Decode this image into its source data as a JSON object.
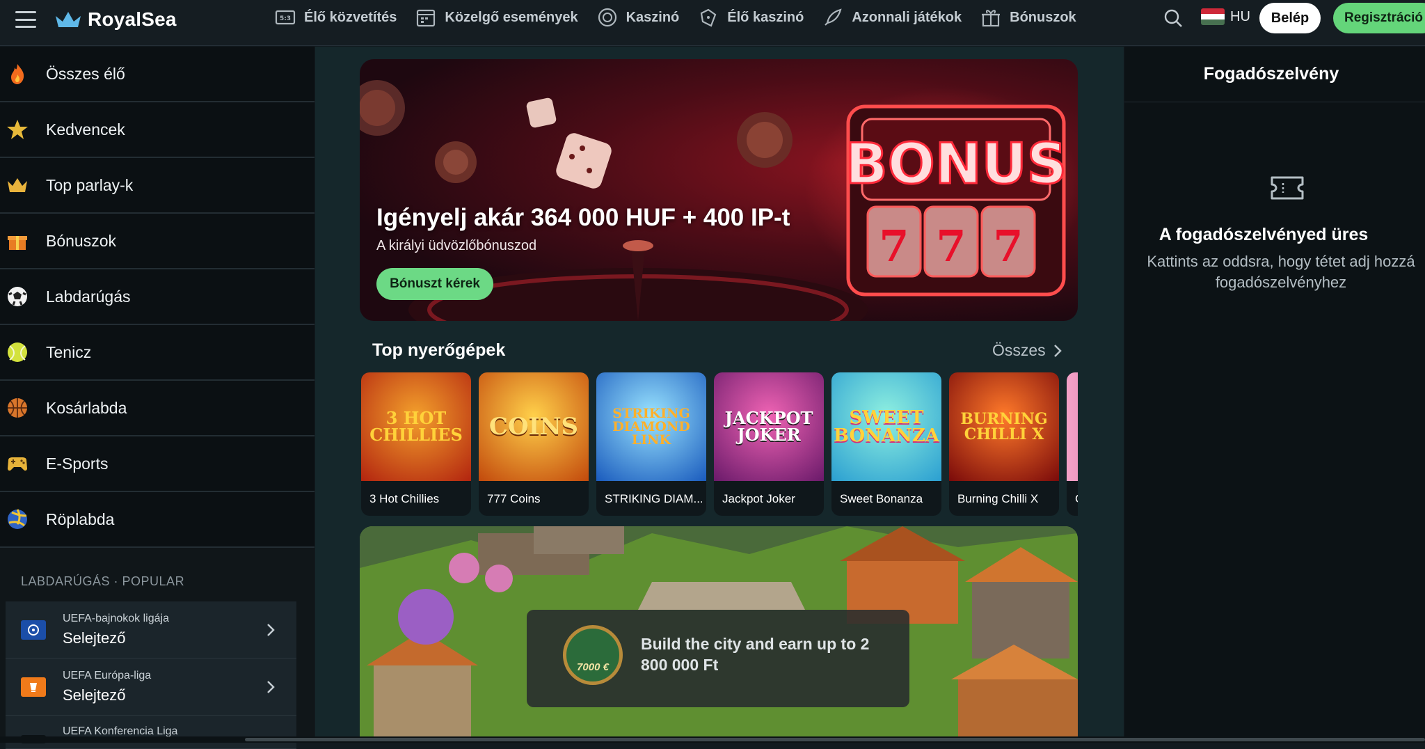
{
  "header": {
    "logo_text": "RoyalSea",
    "nav": [
      {
        "label": "Élő közvetítés",
        "icon": "live-scoreboard-icon"
      },
      {
        "label": "Közelgő események",
        "icon": "calendar-icon"
      },
      {
        "label": "Kaszinó",
        "icon": "casino-chip-icon"
      },
      {
        "label": "Élő kaszinó",
        "icon": "live-casino-icon"
      },
      {
        "label": "Azonnali játékok",
        "icon": "rocket-icon"
      },
      {
        "label": "Bónuszok",
        "icon": "gift-icon"
      }
    ],
    "language": "HU",
    "login_label": "Belép",
    "register_label": "Regisztráció"
  },
  "sidebar": {
    "items": [
      {
        "label": "Összes élő",
        "icon": "fire-icon"
      },
      {
        "label": "Kedvencek",
        "icon": "star-icon"
      },
      {
        "label": "Top parlay-k",
        "icon": "crown-icon"
      },
      {
        "label": "Bónuszok",
        "icon": "gift-icon"
      },
      {
        "label": "Labdarúgás",
        "icon": "soccer-ball-icon"
      },
      {
        "label": "Tenicz",
        "icon": "tennis-ball-icon"
      },
      {
        "label": "Kosárlabda",
        "icon": "basketball-icon"
      },
      {
        "label": "E-Sports",
        "icon": "gamepad-icon"
      },
      {
        "label": "Röplabda",
        "icon": "volleyball-icon"
      }
    ],
    "section_title": "LABDARÚGÁS · POPULAR",
    "leagues": [
      {
        "name": "UEFA-bajnokok ligája",
        "sub": "Selejtező"
      },
      {
        "name": "UEFA Európa-liga",
        "sub": "Selejtező"
      },
      {
        "name": "UEFA Konferencia Liga",
        "sub": ""
      }
    ]
  },
  "main": {
    "hero": {
      "title": "Igényelj akár 364 000 HUF + 400 IP-t",
      "subtitle": "A királyi üdvözlőbónuszod",
      "button": "Bónuszt kérek",
      "sign_text": "BONUS",
      "reel_symbols": [
        "7",
        "7",
        "7"
      ]
    },
    "top_slots": {
      "title": "Top nyerőgépek",
      "see_all": "Összes",
      "games": [
        {
          "name": "3 Hot Chillies",
          "art": "3 HOT CHILLIES",
          "color": "#c8321a"
        },
        {
          "name": "777 Coins",
          "art": "COINS",
          "color": "#d9830f"
        },
        {
          "name": "STRIKING DIAM...",
          "art": "STRIKING DIAMOND LINK",
          "color": "#1d7fd8"
        },
        {
          "name": "Jackpot Joker",
          "art": "JACKPOT JOKER",
          "color": "#b3276f"
        },
        {
          "name": "Sweet Bonanza",
          "art": "SWEET BONANZA",
          "color": "#38c4a5"
        },
        {
          "name": "Burning Chilli X",
          "art": "BURNING CHILLI X",
          "color": "#b11c1c"
        },
        {
          "name": "C",
          "art": "",
          "color": "#c84a86"
        }
      ]
    },
    "promo": {
      "text": "Build the city and earn up to 2 800 000 Ft",
      "coin_label": "7000 €"
    }
  },
  "betslip": {
    "title": "Fogadószelvény",
    "empty_title": "A fogadószelvényed üres",
    "hint": "Kattints az oddsra, hogy tétet adj hozzá fogadószelvényhez"
  }
}
